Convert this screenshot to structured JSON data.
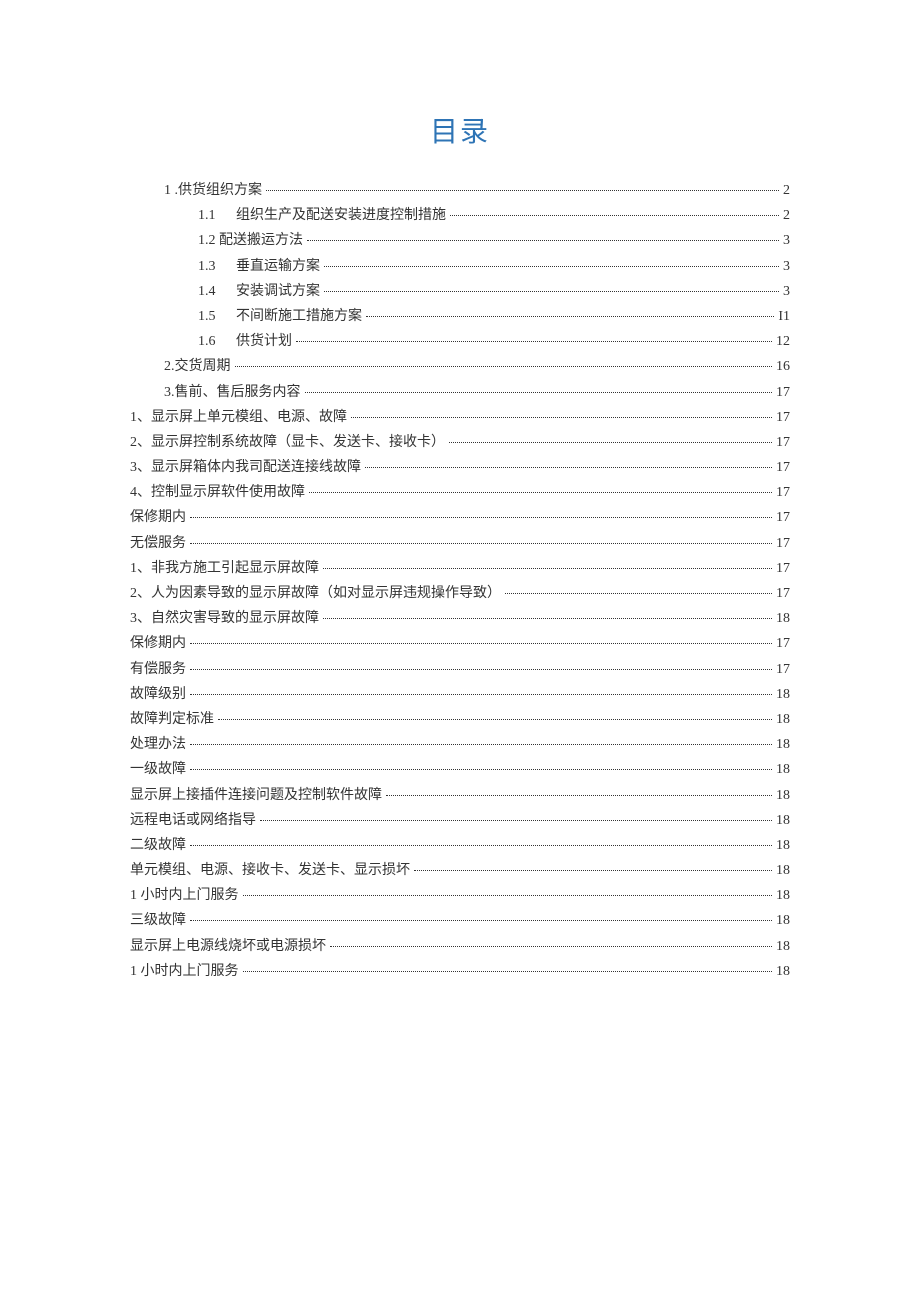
{
  "title": "目录",
  "entries": [
    {
      "indent": "indent-1",
      "text": "1  .供货组织方案",
      "page": "2"
    },
    {
      "indent": "indent-2",
      "prefix": "1.1",
      "text": "组织生产及配送安装进度控制措施",
      "page": "2"
    },
    {
      "indent": "indent-2",
      "text": "1.2 配送搬运方法",
      "page": "3"
    },
    {
      "indent": "indent-2",
      "prefix": "1.3",
      "text": "垂直运输方案",
      "page": "3"
    },
    {
      "indent": "indent-2",
      "prefix": "1.4",
      "text": "安装调试方案",
      "page": "3"
    },
    {
      "indent": "indent-2",
      "prefix": "1.5",
      "text": "不间断施工措施方案",
      "page": "I1"
    },
    {
      "indent": "indent-2",
      "prefix": "1.6",
      "text": "供货计划",
      "page": "12"
    },
    {
      "indent": "indent-1",
      "text": "2.交货周期",
      "page": "16"
    },
    {
      "indent": "indent-1",
      "text": "3.售前、售后服务内容",
      "page": "17"
    },
    {
      "indent": "indent-0",
      "text": "1、显示屏上单元模组、电源、故障",
      "page": "17"
    },
    {
      "indent": "indent-0",
      "text": "2、显示屏控制系统故障（显卡、发送卡、接收卡）",
      "page": "17"
    },
    {
      "indent": "indent-0",
      "text": "3、显示屏箱体内我司配送连接线故障",
      "page": "17"
    },
    {
      "indent": "indent-0",
      "text": "4、控制显示屏软件使用故障",
      "page": "17"
    },
    {
      "indent": "indent-0",
      "text": "保修期内",
      "page": "17"
    },
    {
      "indent": "indent-0",
      "text": "无偿服务",
      "page": "17"
    },
    {
      "indent": "indent-0",
      "text": "1、非我方施工引起显示屏故障",
      "page": "17"
    },
    {
      "indent": "indent-0",
      "text": "2、人为因素导致的显示屏故障（如对显示屏违规操作导致）",
      "page": "17"
    },
    {
      "indent": "indent-0",
      "text": "3、自然灾害导致的显示屏故障",
      "page": "18"
    },
    {
      "indent": "indent-0",
      "text": "保修期内",
      "page": "17"
    },
    {
      "indent": "indent-0",
      "text": "有偿服务",
      "page": "17"
    },
    {
      "indent": "indent-0",
      "text": "故障级别",
      "page": "18"
    },
    {
      "indent": "indent-0",
      "text": "故障判定标准",
      "page": "18"
    },
    {
      "indent": "indent-0",
      "text": "处理办法",
      "page": "18"
    },
    {
      "indent": "indent-0",
      "text": "一级故障",
      "page": "18"
    },
    {
      "indent": "indent-0",
      "text": "显示屏上接插件连接问题及控制软件故障",
      "page": "18"
    },
    {
      "indent": "indent-0",
      "text": "远程电话或网络指导",
      "page": "18"
    },
    {
      "indent": "indent-0",
      "text": "二级故障",
      "page": "18"
    },
    {
      "indent": "indent-0",
      "text": "单元模组、电源、接收卡、发送卡、显示损坏",
      "page": "18"
    },
    {
      "indent": "indent-0",
      "text": "1 小时内上门服务",
      "page": "18"
    },
    {
      "indent": "indent-0",
      "text": "三级故障",
      "page": "18"
    },
    {
      "indent": "indent-0",
      "text": "显示屏上电源线烧坏或电源损坏",
      "page": "18"
    },
    {
      "indent": "indent-0",
      "text": "1 小时内上门服务",
      "page": "18"
    }
  ]
}
